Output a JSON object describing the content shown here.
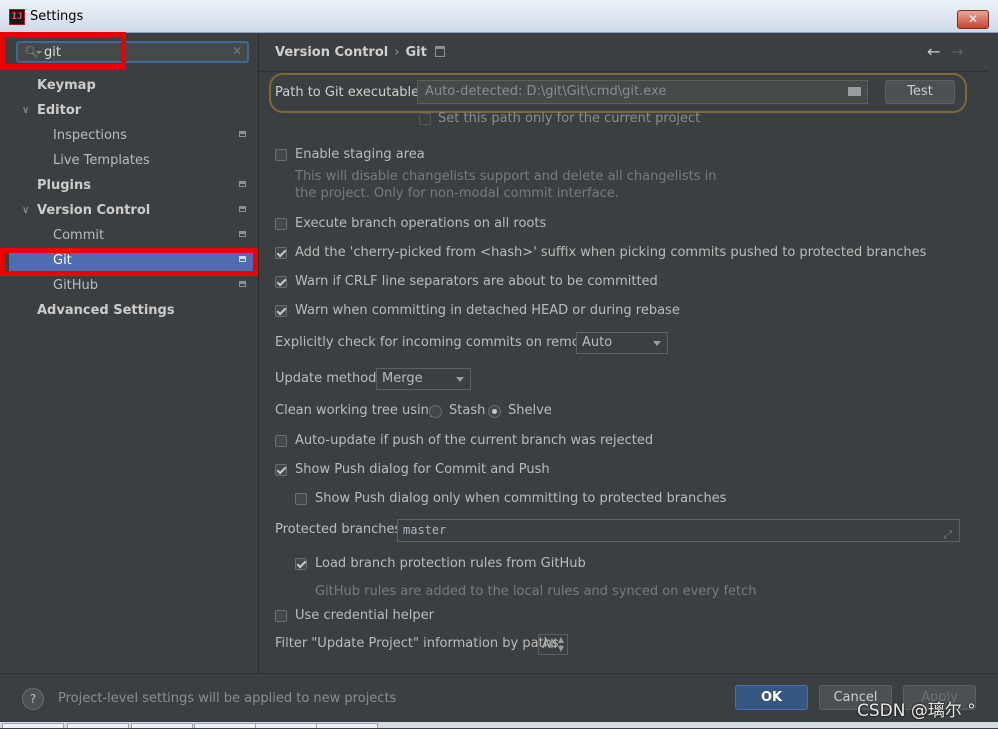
{
  "window": {
    "title": "Settings",
    "close_label": "✕"
  },
  "search": {
    "value": "git"
  },
  "sidebar": {
    "items": [
      {
        "label": "Keymap"
      },
      {
        "label": "Editor"
      },
      {
        "label": "Inspections"
      },
      {
        "label": "Live Templates"
      },
      {
        "label": "Plugins"
      },
      {
        "label": "Version Control"
      },
      {
        "label": "Commit"
      },
      {
        "label": "Git"
      },
      {
        "label": "GitHub"
      },
      {
        "label": "Advanced Settings"
      }
    ]
  },
  "breadcrumb": {
    "parent": "Version Control",
    "current": "Git",
    "separator": "›"
  },
  "git_path": {
    "label": "Path to Git executable:",
    "placeholder": "Auto-detected: D:\\git\\Git\\cmd\\git.exe",
    "test_label": "Test",
    "current_project_label": "Set this path only for the current project"
  },
  "staging": {
    "label": "Enable staging area",
    "hint_line1": "This will disable changelists support and delete all changelists in",
    "hint_line2": "the project. Only for non-modal commit interface."
  },
  "options": {
    "branch_ops": "Execute branch operations on all roots",
    "cherry_pick": "Add the 'cherry-picked from <hash>' suffix when picking commits pushed to protected branches",
    "crlf": "Warn if CRLF line separators are about to be committed",
    "detached": "Warn when committing in detached HEAD or during rebase"
  },
  "incoming": {
    "label": "Explicitly check for incoming commits on remotes:",
    "value": "Auto"
  },
  "update_method": {
    "label": "Update method:",
    "value": "Merge"
  },
  "clean_tree": {
    "label": "Clean working tree using:",
    "stash": "Stash",
    "shelve": "Shelve",
    "selected": "Shelve"
  },
  "push": {
    "auto_update": "Auto-update if push of the current branch was rejected",
    "show_dialog": "Show Push dialog for Commit and Push",
    "only_protected": "Show Push dialog only when committing to protected branches"
  },
  "protected": {
    "label": "Protected branches:",
    "value": "master",
    "load_rules": "Load branch protection rules from GitHub",
    "rules_hint": "GitHub rules are added to the local rules and synced on every fetch"
  },
  "credential": {
    "label": "Use credential helper"
  },
  "filter": {
    "label": "Filter \"Update Project\" information by paths:",
    "value": "All"
  },
  "footer": {
    "help": "?",
    "note": "Project-level settings will be applied to new projects",
    "ok": "OK",
    "cancel": "Cancel",
    "apply": "Apply"
  },
  "watermark": "CSDN @璃尔 °",
  "colors": {
    "accent": "#4b6eaf",
    "highlight": "#ee0000",
    "background": "#3c3f41"
  },
  "icons": {
    "search": "search-icon",
    "clear": "clear-icon",
    "folder": "folder-icon",
    "back": "arrow-left-icon",
    "forward": "arrow-right-icon",
    "help": "help-icon",
    "expand": "expand-icon"
  }
}
